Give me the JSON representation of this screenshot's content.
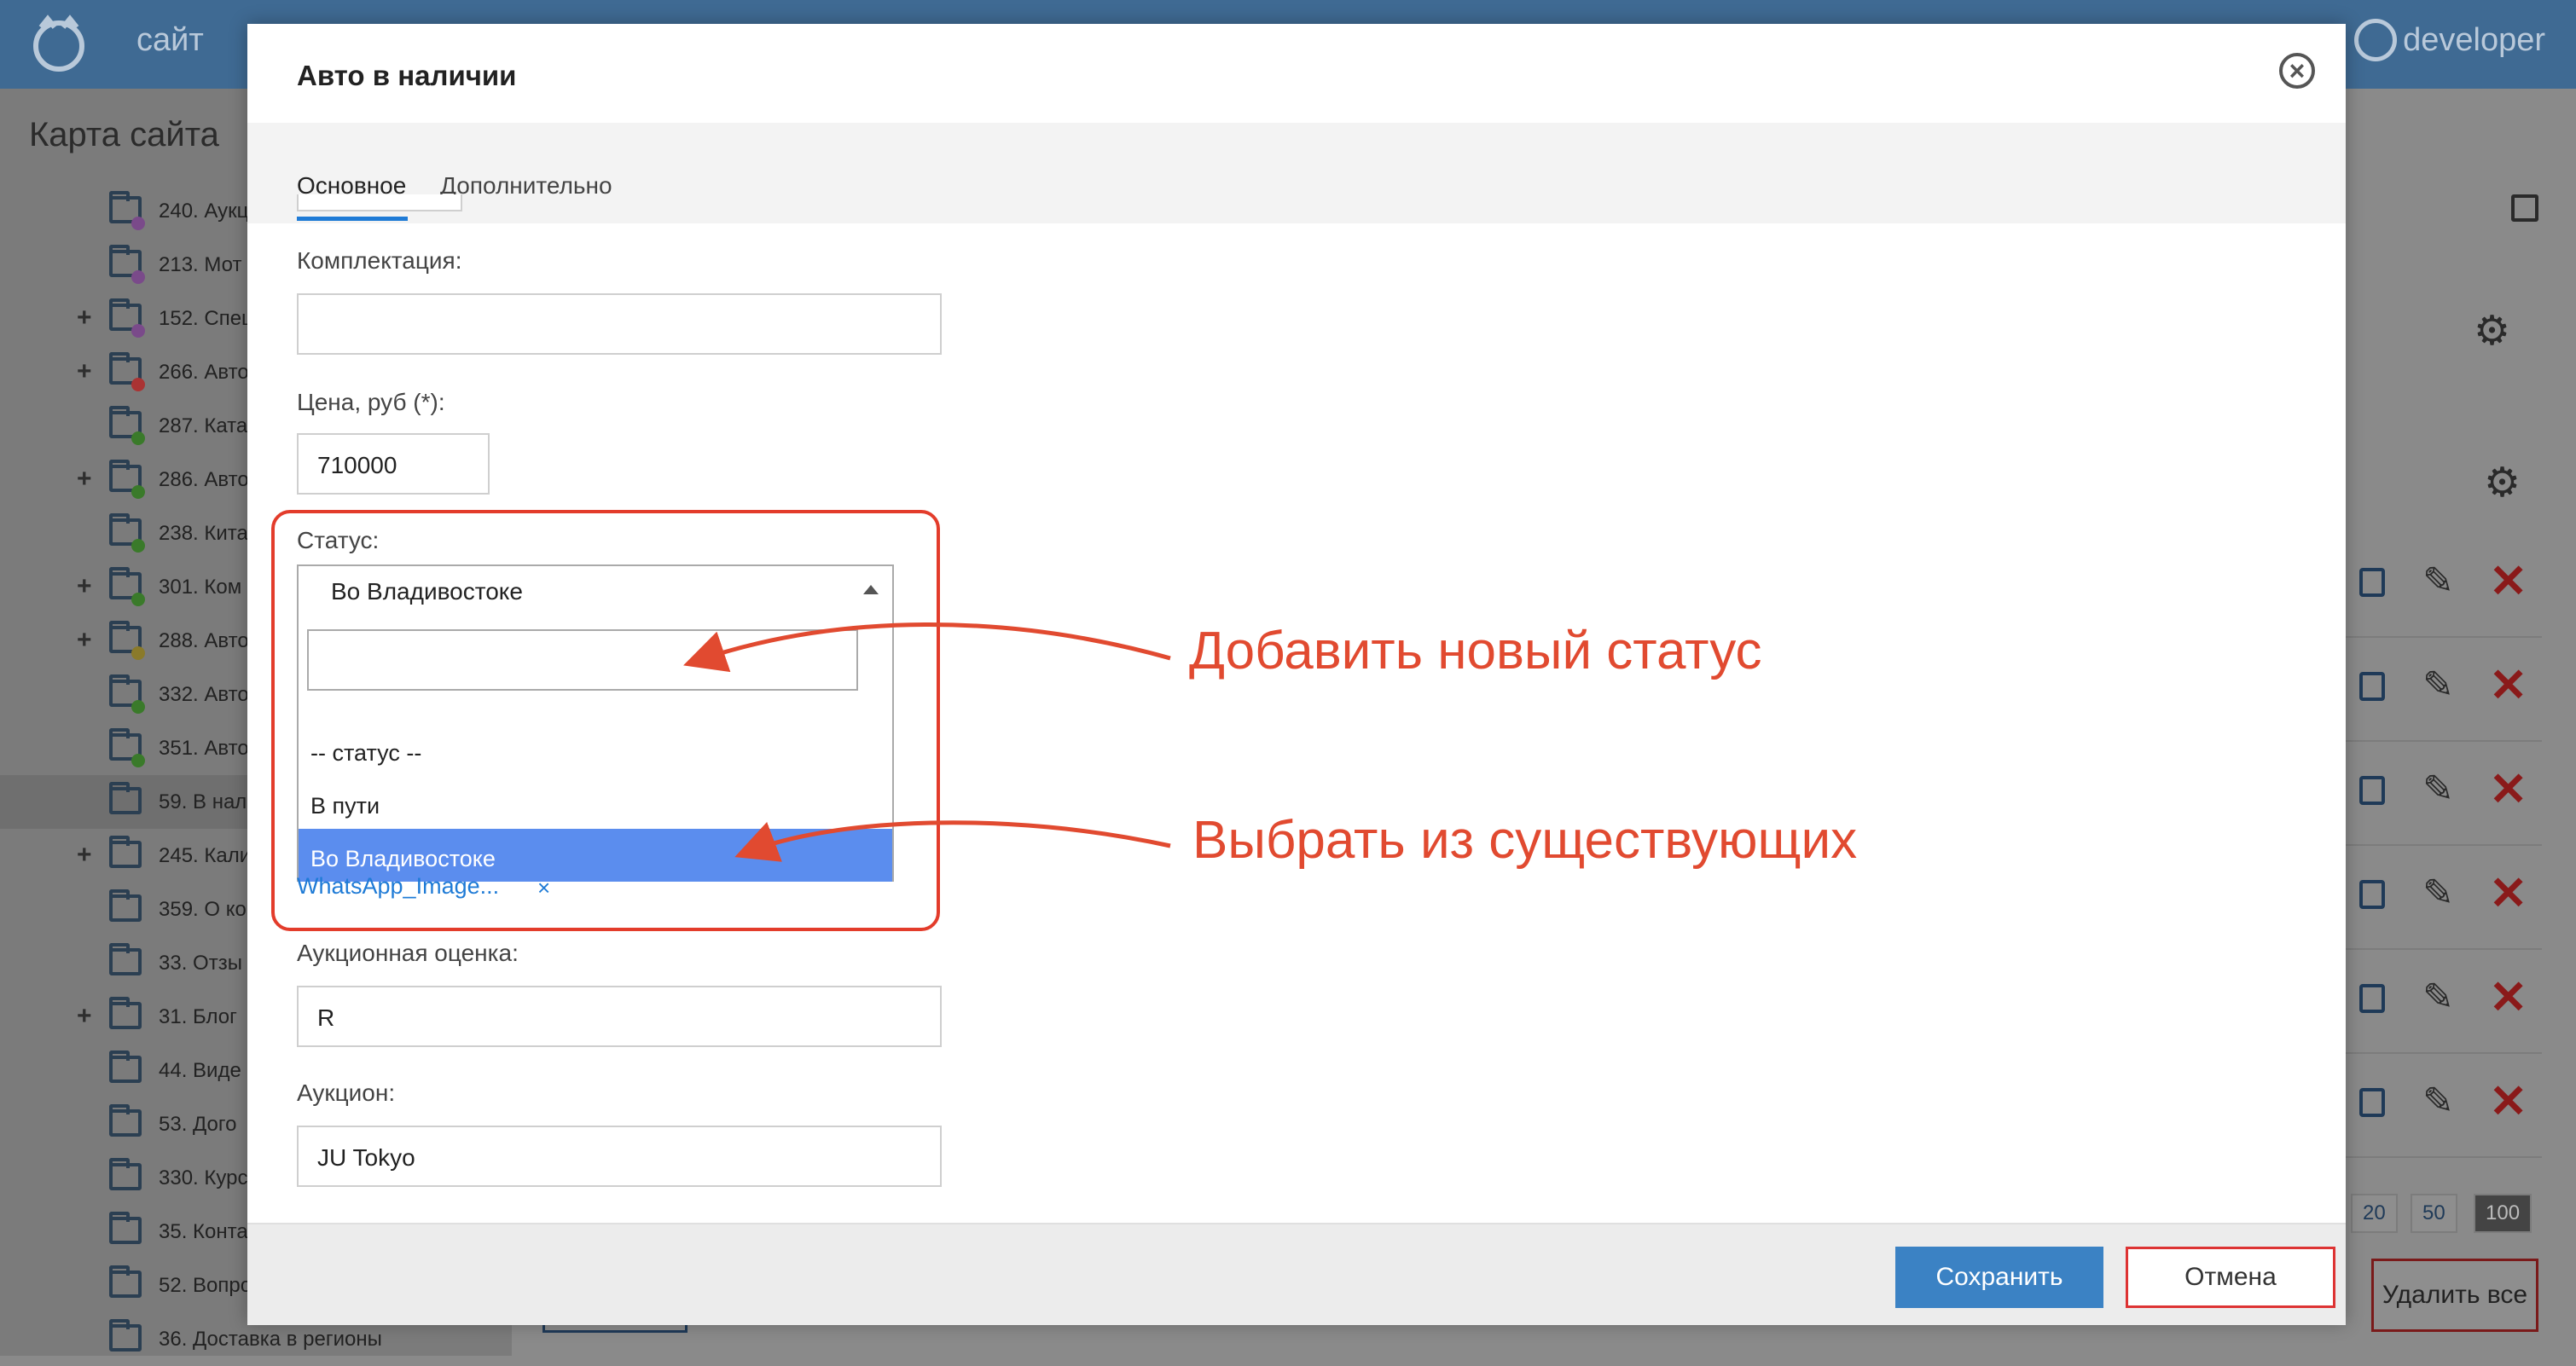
{
  "topbar": {
    "brand": "сайт",
    "user": "developer"
  },
  "sidebar": {
    "title": "Карта сайта",
    "items": [
      {
        "label": "240. Аукц",
        "plus": false,
        "dot": "#7a4a8a"
      },
      {
        "label": "213. Мот",
        "plus": false,
        "dot": "#7a4a8a"
      },
      {
        "label": "152. Спец",
        "plus": true,
        "dot": "#7a4a8a"
      },
      {
        "label": "266. Авто",
        "plus": true,
        "dot": "#a33"
      },
      {
        "label": "287. Ката",
        "plus": false,
        "dot": "#3a7a2a"
      },
      {
        "label": "286. Авто",
        "plus": true,
        "dot": "#3a7a2a"
      },
      {
        "label": "238. Кита",
        "plus": false,
        "dot": "#3a7a2a"
      },
      {
        "label": "301. Ком",
        "plus": true,
        "dot": "#3a7a2a"
      },
      {
        "label": "288. Авто",
        "plus": true,
        "dot": "#8a7a2a"
      },
      {
        "label": "332. Авто",
        "plus": false,
        "dot": "#3a7a2a"
      },
      {
        "label": "351. Авто",
        "plus": false,
        "dot": "#3a7a2a"
      },
      {
        "label": "59. В нал",
        "plus": false,
        "dot": ""
      },
      {
        "label": "245. Кали",
        "plus": true,
        "dot": ""
      },
      {
        "label": "359. О ко",
        "plus": false,
        "dot": ""
      },
      {
        "label": "33. Отзы",
        "plus": false,
        "dot": ""
      },
      {
        "label": "31. Блог",
        "plus": true,
        "dot": ""
      },
      {
        "label": "44. Виде",
        "plus": false,
        "dot": ""
      },
      {
        "label": "53. Дого",
        "plus": false,
        "dot": ""
      },
      {
        "label": "330. Курс",
        "plus": false,
        "dot": ""
      },
      {
        "label": "35. Конта",
        "plus": false,
        "dot": ""
      },
      {
        "label": "52. Вопро",
        "plus": false,
        "dot": ""
      },
      {
        "label": "36. Доставка в регионы",
        "plus": false,
        "dot": ""
      }
    ]
  },
  "pager": [
    "20",
    "50",
    "100"
  ],
  "delete_all": "Удалить все",
  "modal": {
    "title": "Авто в наличии",
    "tabs": [
      "Основное",
      "Дополнительно"
    ],
    "fields": {
      "equipment_label": "Комплектация:",
      "equipment_value": "",
      "price_label": "Цена, руб (*):",
      "price_value": "710000",
      "status_label": "Статус:",
      "status_value": "Во Владивостоке",
      "status_search": "",
      "status_options": [
        "-- статус --",
        "В пути",
        "Во Владивостоке"
      ],
      "attachment": "WhatsApp_Image...",
      "attachment_remove": "×",
      "auction_grade_label": "Аукционная оценка:",
      "auction_grade_value": "R",
      "auction_label": "Аукцион:",
      "auction_value": "JU Tokyo"
    },
    "buttons": {
      "save": "Сохранить",
      "cancel": "Отмена"
    }
  },
  "annotations": {
    "add_status": "Добавить новый статус",
    "choose_existing": "Выбрать из существующих"
  },
  "colors": {
    "accent": "#1f7bd6",
    "annotation": "#e14a30",
    "topbar": "#3f6a93"
  }
}
